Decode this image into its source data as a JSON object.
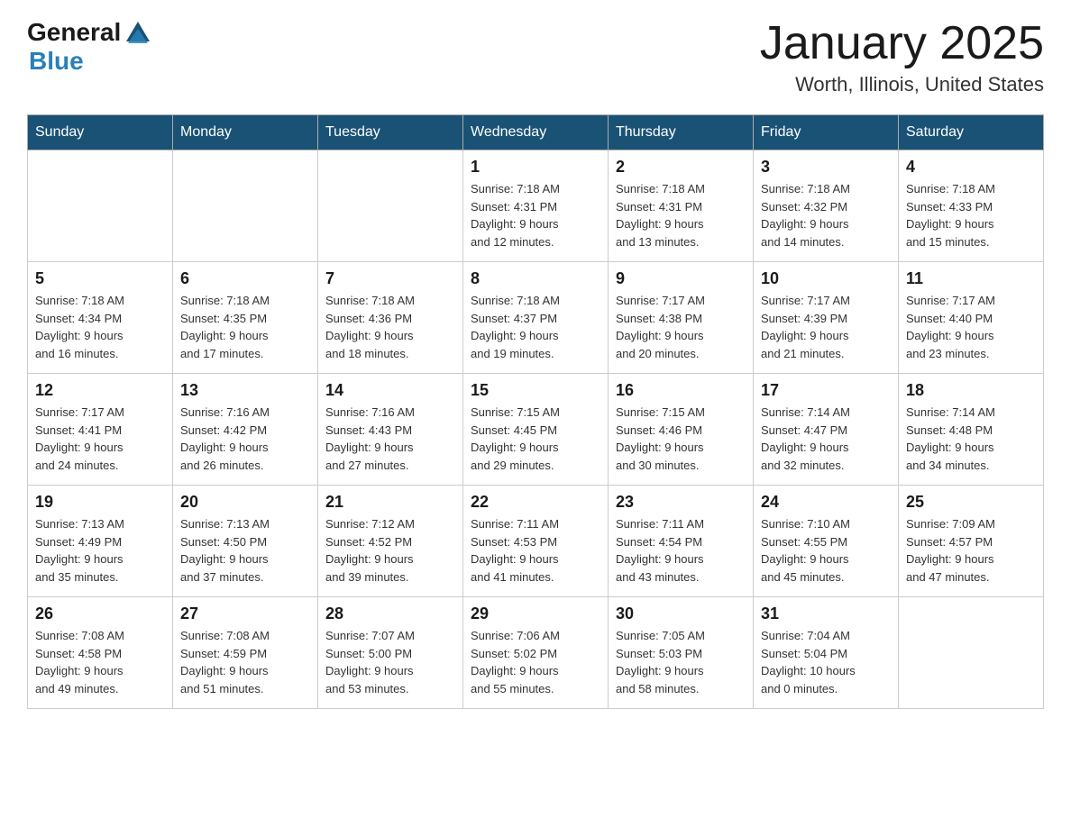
{
  "header": {
    "logo": {
      "general": "General",
      "blue": "Blue"
    },
    "title": "January 2025",
    "subtitle": "Worth, Illinois, United States"
  },
  "days_of_week": [
    "Sunday",
    "Monday",
    "Tuesday",
    "Wednesday",
    "Thursday",
    "Friday",
    "Saturday"
  ],
  "weeks": [
    [
      {
        "day": "",
        "info": ""
      },
      {
        "day": "",
        "info": ""
      },
      {
        "day": "",
        "info": ""
      },
      {
        "day": "1",
        "info": "Sunrise: 7:18 AM\nSunset: 4:31 PM\nDaylight: 9 hours\nand 12 minutes."
      },
      {
        "day": "2",
        "info": "Sunrise: 7:18 AM\nSunset: 4:31 PM\nDaylight: 9 hours\nand 13 minutes."
      },
      {
        "day": "3",
        "info": "Sunrise: 7:18 AM\nSunset: 4:32 PM\nDaylight: 9 hours\nand 14 minutes."
      },
      {
        "day": "4",
        "info": "Sunrise: 7:18 AM\nSunset: 4:33 PM\nDaylight: 9 hours\nand 15 minutes."
      }
    ],
    [
      {
        "day": "5",
        "info": "Sunrise: 7:18 AM\nSunset: 4:34 PM\nDaylight: 9 hours\nand 16 minutes."
      },
      {
        "day": "6",
        "info": "Sunrise: 7:18 AM\nSunset: 4:35 PM\nDaylight: 9 hours\nand 17 minutes."
      },
      {
        "day": "7",
        "info": "Sunrise: 7:18 AM\nSunset: 4:36 PM\nDaylight: 9 hours\nand 18 minutes."
      },
      {
        "day": "8",
        "info": "Sunrise: 7:18 AM\nSunset: 4:37 PM\nDaylight: 9 hours\nand 19 minutes."
      },
      {
        "day": "9",
        "info": "Sunrise: 7:17 AM\nSunset: 4:38 PM\nDaylight: 9 hours\nand 20 minutes."
      },
      {
        "day": "10",
        "info": "Sunrise: 7:17 AM\nSunset: 4:39 PM\nDaylight: 9 hours\nand 21 minutes."
      },
      {
        "day": "11",
        "info": "Sunrise: 7:17 AM\nSunset: 4:40 PM\nDaylight: 9 hours\nand 23 minutes."
      }
    ],
    [
      {
        "day": "12",
        "info": "Sunrise: 7:17 AM\nSunset: 4:41 PM\nDaylight: 9 hours\nand 24 minutes."
      },
      {
        "day": "13",
        "info": "Sunrise: 7:16 AM\nSunset: 4:42 PM\nDaylight: 9 hours\nand 26 minutes."
      },
      {
        "day": "14",
        "info": "Sunrise: 7:16 AM\nSunset: 4:43 PM\nDaylight: 9 hours\nand 27 minutes."
      },
      {
        "day": "15",
        "info": "Sunrise: 7:15 AM\nSunset: 4:45 PM\nDaylight: 9 hours\nand 29 minutes."
      },
      {
        "day": "16",
        "info": "Sunrise: 7:15 AM\nSunset: 4:46 PM\nDaylight: 9 hours\nand 30 minutes."
      },
      {
        "day": "17",
        "info": "Sunrise: 7:14 AM\nSunset: 4:47 PM\nDaylight: 9 hours\nand 32 minutes."
      },
      {
        "day": "18",
        "info": "Sunrise: 7:14 AM\nSunset: 4:48 PM\nDaylight: 9 hours\nand 34 minutes."
      }
    ],
    [
      {
        "day": "19",
        "info": "Sunrise: 7:13 AM\nSunset: 4:49 PM\nDaylight: 9 hours\nand 35 minutes."
      },
      {
        "day": "20",
        "info": "Sunrise: 7:13 AM\nSunset: 4:50 PM\nDaylight: 9 hours\nand 37 minutes."
      },
      {
        "day": "21",
        "info": "Sunrise: 7:12 AM\nSunset: 4:52 PM\nDaylight: 9 hours\nand 39 minutes."
      },
      {
        "day": "22",
        "info": "Sunrise: 7:11 AM\nSunset: 4:53 PM\nDaylight: 9 hours\nand 41 minutes."
      },
      {
        "day": "23",
        "info": "Sunrise: 7:11 AM\nSunset: 4:54 PM\nDaylight: 9 hours\nand 43 minutes."
      },
      {
        "day": "24",
        "info": "Sunrise: 7:10 AM\nSunset: 4:55 PM\nDaylight: 9 hours\nand 45 minutes."
      },
      {
        "day": "25",
        "info": "Sunrise: 7:09 AM\nSunset: 4:57 PM\nDaylight: 9 hours\nand 47 minutes."
      }
    ],
    [
      {
        "day": "26",
        "info": "Sunrise: 7:08 AM\nSunset: 4:58 PM\nDaylight: 9 hours\nand 49 minutes."
      },
      {
        "day": "27",
        "info": "Sunrise: 7:08 AM\nSunset: 4:59 PM\nDaylight: 9 hours\nand 51 minutes."
      },
      {
        "day": "28",
        "info": "Sunrise: 7:07 AM\nSunset: 5:00 PM\nDaylight: 9 hours\nand 53 minutes."
      },
      {
        "day": "29",
        "info": "Sunrise: 7:06 AM\nSunset: 5:02 PM\nDaylight: 9 hours\nand 55 minutes."
      },
      {
        "day": "30",
        "info": "Sunrise: 7:05 AM\nSunset: 5:03 PM\nDaylight: 9 hours\nand 58 minutes."
      },
      {
        "day": "31",
        "info": "Sunrise: 7:04 AM\nSunset: 5:04 PM\nDaylight: 10 hours\nand 0 minutes."
      },
      {
        "day": "",
        "info": ""
      }
    ]
  ]
}
